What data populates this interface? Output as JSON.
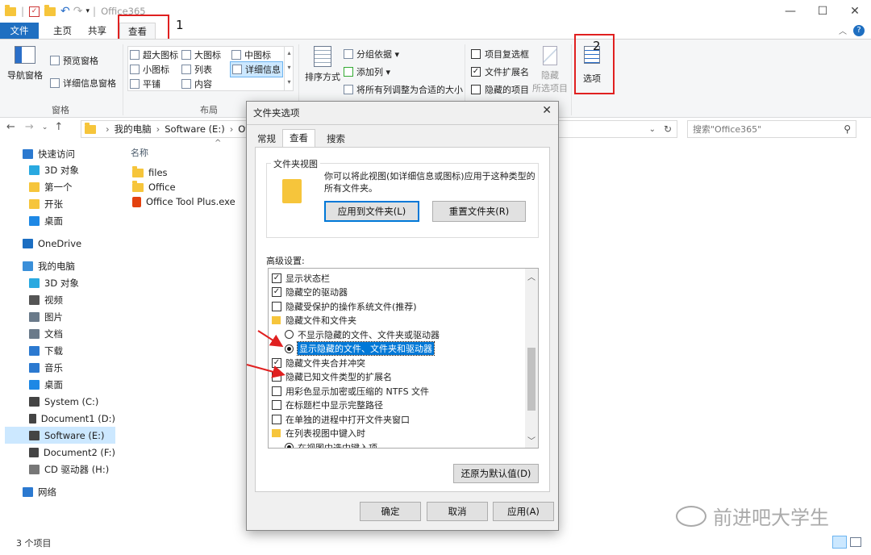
{
  "window": {
    "title": "Office365",
    "minimize": "—",
    "maximize": "☐",
    "close": "✕",
    "help": "?"
  },
  "menu": {
    "file": "文件",
    "home": "主页",
    "share": "共享",
    "view": "查看"
  },
  "annotations": {
    "n1": "1",
    "n2": "2"
  },
  "ribbon": {
    "pane": {
      "nav_pane": "导航窗格",
      "preview_pane": "预览窗格",
      "details_pane": "详细信息窗格",
      "group_label": "窗格"
    },
    "layout": {
      "items": [
        "超大图标",
        "大图标",
        "中图标",
        "小图标",
        "列表",
        "详细信息",
        "平铺",
        "内容"
      ],
      "group_label": "布局"
    },
    "current_view": {
      "sort_by": "排序方式",
      "group_by": "分组依据 ▾",
      "add_columns": "添加列 ▾",
      "size_all": "将所有列调整为合适的大小"
    },
    "show_hide": {
      "item_checkboxes": "项目复选框",
      "file_ext": "文件扩展名",
      "hidden_items": "隐藏的项目",
      "hide": "隐藏",
      "hide_selected": "所选项目"
    },
    "options": "选项"
  },
  "address": {
    "path": [
      "我的电脑",
      "Software (E:)",
      "Offi"
    ],
    "search_placeholder": "搜索\"Office365\""
  },
  "nav": {
    "items": [
      {
        "label": "快速访问",
        "icon": "star-icon",
        "color": "#2b79d0"
      },
      {
        "label": "3D 对象",
        "icon": "cube-icon",
        "color": "#29a9e0"
      },
      {
        "label": "第一个",
        "icon": "folder-icon",
        "color": "#f6c53b"
      },
      {
        "label": "开张",
        "icon": "folder-icon",
        "color": "#f6c53b"
      },
      {
        "label": "桌面",
        "icon": "desktop-icon",
        "color": "#1e88e5"
      },
      {
        "label": "OneDrive",
        "icon": "cloud-icon",
        "color": "#1b6ec2"
      },
      {
        "label": "我的电脑",
        "icon": "computer-icon",
        "color": "#3a8fd9"
      },
      {
        "label": "3D 对象",
        "icon": "cube-icon",
        "color": "#29a9e0"
      },
      {
        "label": "视频",
        "icon": "video-icon",
        "color": "#555"
      },
      {
        "label": "图片",
        "icon": "picture-icon",
        "color": "#6a7a8a"
      },
      {
        "label": "文档",
        "icon": "document-icon",
        "color": "#6a7a8a"
      },
      {
        "label": "下载",
        "icon": "download-icon",
        "color": "#2b79d0"
      },
      {
        "label": "音乐",
        "icon": "music-icon",
        "color": "#2b79d0"
      },
      {
        "label": "桌面",
        "icon": "desktop-icon",
        "color": "#1e88e5"
      },
      {
        "label": "System (C:)",
        "icon": "drive-icon",
        "color": "#444"
      },
      {
        "label": "Document1 (D:)",
        "icon": "drive-icon",
        "color": "#444"
      },
      {
        "label": "Software (E:)",
        "icon": "drive-icon",
        "color": "#444"
      },
      {
        "label": "Document2 (F:)",
        "icon": "drive-icon",
        "color": "#444"
      },
      {
        "label": "CD 驱动器 (H:)",
        "icon": "cd-icon",
        "color": "#777"
      },
      {
        "label": "网络",
        "icon": "network-icon",
        "color": "#2b79d0"
      }
    ]
  },
  "files": {
    "column_name": "名称",
    "rows": [
      "files",
      "Office",
      "Office Tool Plus.exe"
    ]
  },
  "status": {
    "count": "3 个项目"
  },
  "dialog": {
    "title": "文件夹选项",
    "tabs": [
      "常规",
      "查看",
      "搜索"
    ],
    "folder_views": {
      "legend": "文件夹视图",
      "desc": "你可以将此视图(如详细信息或图标)应用于这种类型的所有文件夹。",
      "apply": "应用到文件夹(L)",
      "reset": "重置文件夹(R)"
    },
    "advanced_label": "高级设置:",
    "advanced": [
      {
        "type": "checkbox",
        "checked": true,
        "label": "显示状态栏"
      },
      {
        "type": "checkbox",
        "checked": true,
        "label": "隐藏空的驱动器"
      },
      {
        "type": "checkbox",
        "checked": false,
        "label": "隐藏受保护的操作系统文件(推荐)"
      },
      {
        "type": "folder",
        "label": "隐藏文件和文件夹"
      },
      {
        "type": "radio",
        "checked": false,
        "label": "不显示隐藏的文件、文件夹或驱动器"
      },
      {
        "type": "radio",
        "checked": true,
        "label": "显示隐藏的文件、文件夹和驱动器"
      },
      {
        "type": "checkbox",
        "checked": true,
        "label": "隐藏文件夹合并冲突"
      },
      {
        "type": "checkbox",
        "checked": false,
        "label": "隐藏已知文件类型的扩展名"
      },
      {
        "type": "checkbox",
        "checked": false,
        "label": "用彩色显示加密或压缩的 NTFS 文件"
      },
      {
        "type": "checkbox",
        "checked": false,
        "label": "在标题栏中显示完整路径"
      },
      {
        "type": "checkbox",
        "checked": false,
        "label": "在单独的进程中打开文件夹窗口"
      },
      {
        "type": "folder",
        "label": "在列表视图中键入时"
      },
      {
        "type": "radio",
        "checked": true,
        "label": "在视图中选中键入项"
      }
    ],
    "restore_defaults": "还原为默认值(D)",
    "ok": "确定",
    "cancel": "取消",
    "apply": "应用(A)"
  },
  "watermark": "前进吧大学生"
}
